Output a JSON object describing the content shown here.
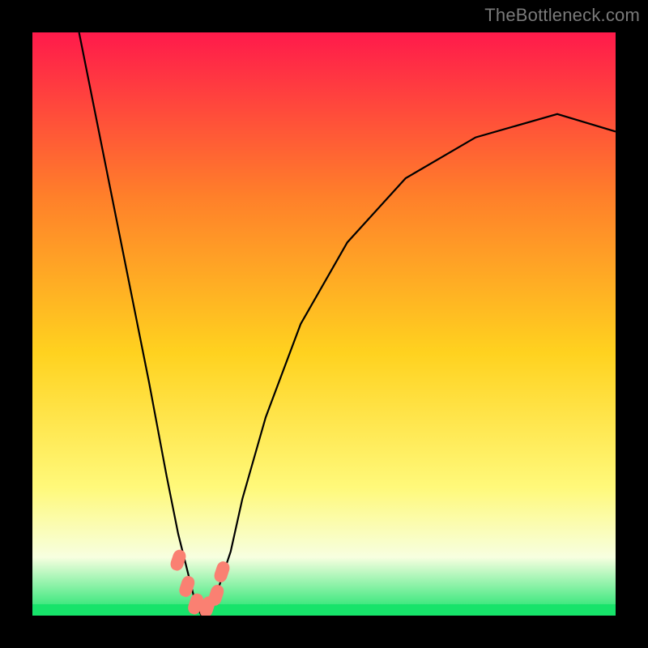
{
  "watermark": "TheBottleneck.com",
  "chart_data": {
    "type": "line",
    "title": "",
    "xlabel": "",
    "ylabel": "",
    "xlim": [
      0,
      100
    ],
    "ylim": [
      0,
      100
    ],
    "background_gradient": {
      "top": "#ff1a4b",
      "mid_upper": "#ff7f2a",
      "mid": "#ffd21f",
      "mid_lower": "#fff97a",
      "band": "#f7ffe0",
      "bottom": "#17e36a"
    },
    "series": [
      {
        "name": "bottleneck-curve",
        "stroke": "#000000",
        "x": [
          8,
          12,
          16,
          20,
          23,
          25,
          27,
          28,
          29,
          30,
          31,
          32,
          34,
          36,
          40,
          46,
          54,
          64,
          76,
          90,
          100
        ],
        "values": [
          100,
          80,
          60,
          40,
          24,
          14,
          6,
          2,
          0,
          0,
          2,
          5,
          11,
          20,
          34,
          50,
          64,
          75,
          82,
          86,
          83
        ]
      }
    ],
    "markers": {
      "name": "cluster-points",
      "color": "#fa8072",
      "points": [
        {
          "x": 25.0,
          "y": 9.5
        },
        {
          "x": 26.5,
          "y": 5.0
        },
        {
          "x": 28.0,
          "y": 2.0
        },
        {
          "x": 30.0,
          "y": 1.5
        },
        {
          "x": 31.5,
          "y": 3.5
        },
        {
          "x": 32.5,
          "y": 7.5
        }
      ]
    }
  }
}
